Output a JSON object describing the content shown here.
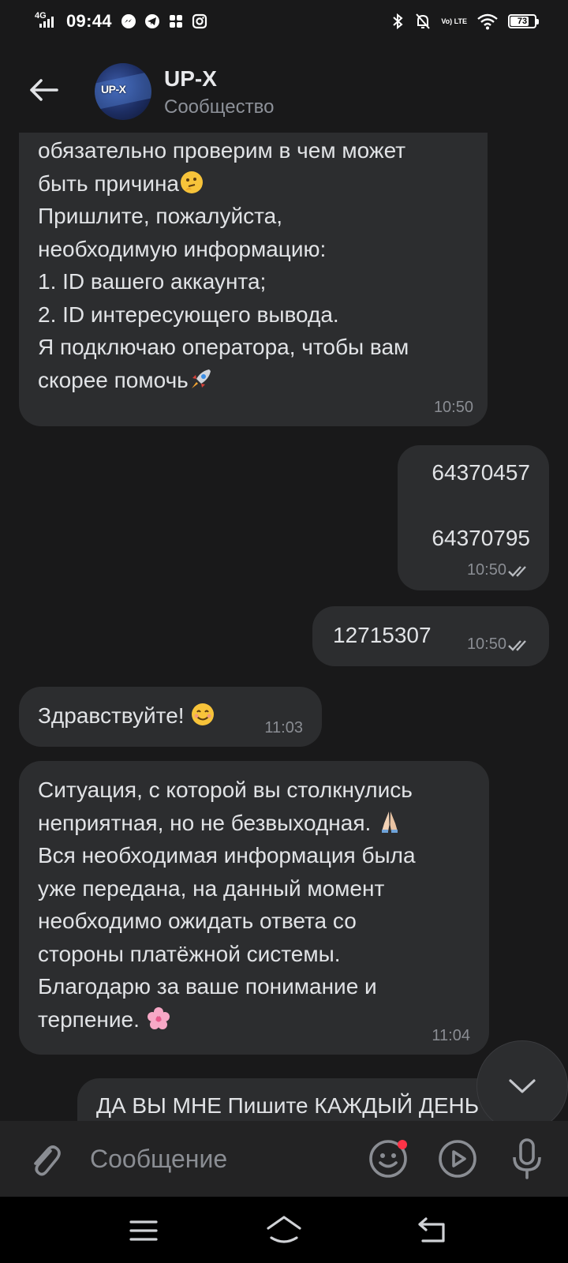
{
  "status_bar": {
    "network": "4G",
    "time": "09:44",
    "volte": "Vo) LTE",
    "battery": "73",
    "battery_level": 0.73,
    "icons": [
      "messenger-icon",
      "telegram-icon",
      "apps-icon",
      "instagram-icon",
      "bluetooth-icon",
      "mute-icon",
      "volte-icon",
      "wifi-icon",
      "battery-icon"
    ]
  },
  "header": {
    "title": "UP-X",
    "subtitle": "Сообщество",
    "avatar_text": "UP-X"
  },
  "messages": [
    {
      "text": "обязательно проверим в чем может\nбыть причина",
      "text2": "Пришлите, пожалуйста,\nнеобходимую информацию:\n1. ID вашего аккаунта;\n2. ID интересующего вывода.\nЯ подключаю оператора, чтобы вам\nскорее помочь",
      "time": "10:50",
      "direction": "incoming"
    },
    {
      "text": "64370457\n\n64370795",
      "time": "10:50",
      "direction": "outgoing",
      "status": "read"
    },
    {
      "text": "12715307",
      "time": "10:50",
      "direction": "outgoing",
      "status": "read"
    },
    {
      "text": "Здравствуйте!",
      "time": "11:03",
      "direction": "incoming"
    },
    {
      "text": "Ситуация, с которой вы столкнулись\nнеприятная, но не безвыходная.",
      "text2": "Вся необходимая информация была\nуже передана, на данный момент\nнеобходимо ожидать ответа со\nстороны платёжной системы.\nБлагодарю за ваше понимание и\nтерпение.",
      "time": "11:04",
      "direction": "incoming"
    },
    {
      "text": "ДА ВЫ МНЕ Пишите КАЖДЫЙ ДЕНЬ",
      "direction": "outgoing"
    }
  ],
  "composer": {
    "placeholder": "Сообщение"
  },
  "colors": {
    "background": "#19191a",
    "bubble": "#2c2d2f",
    "text": "#e1e3e6",
    "secondary": "#8a8d93",
    "badge": "#ff3347"
  }
}
